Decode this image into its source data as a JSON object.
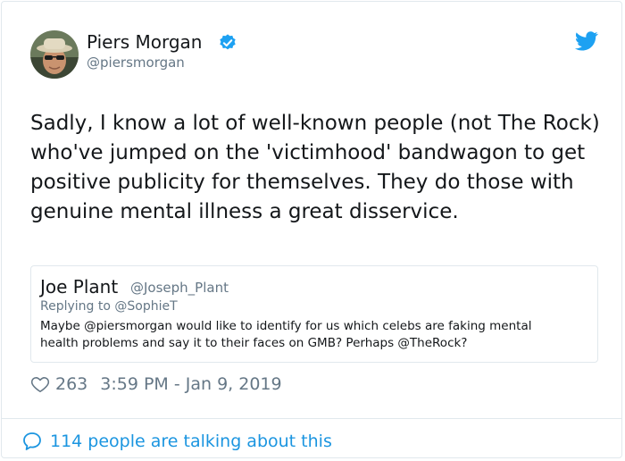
{
  "author": {
    "name": "Piers Morgan",
    "handle": "@piersmorgan"
  },
  "tweet": {
    "text": "Sadly, I know a lot of well-known people (not The Rock) who've jumped on the 'victimhood' bandwagon to get positive publicity for themselves. They do those with genuine mental illness a great disservice."
  },
  "quoted": {
    "name": "Joe Plant",
    "handle": "@Joseph_Plant",
    "replying_to": "Replying to @SophieT",
    "text": "Maybe @piersmorgan would like to identify for us which celebs are faking mental health problems and say it to their faces on GMB? Perhaps @TheRock?"
  },
  "meta": {
    "likes": "263",
    "timestamp": "3:59 PM - Jan 9, 2019"
  },
  "footer": {
    "talking": "114 people are talking about this"
  },
  "colors": {
    "twitter_blue": "#1da1f2",
    "link_blue": "#1b95e0",
    "muted": "#657786",
    "border": "#e1e8ed"
  },
  "icons": [
    "verified-badge-icon",
    "twitter-bird-icon",
    "heart-icon",
    "speech-bubble-icon"
  ]
}
